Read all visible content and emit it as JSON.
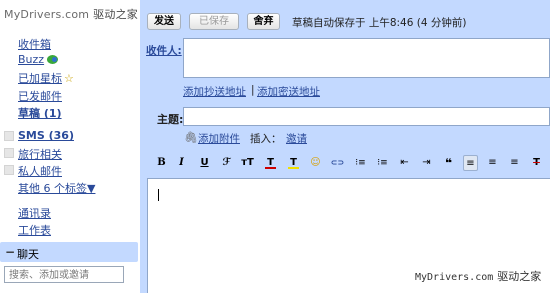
{
  "logo": {
    "text": "MyDrivers.com",
    "cn": "驱动之家"
  },
  "sidebar": {
    "items": [
      {
        "label": "收件箱"
      },
      {
        "label": "Buzz"
      },
      {
        "label": "已加星标"
      },
      {
        "label": "已发邮件"
      },
      {
        "label": "草稿 (1)"
      }
    ],
    "labels": [
      {
        "label": "SMS (36)"
      },
      {
        "label": "旅行相关"
      },
      {
        "label": "私人邮件"
      },
      {
        "label": "其他 6 个标签▼"
      }
    ],
    "contacts": "通讯录",
    "tasks": "工作表"
  },
  "chat": {
    "title": "聊天",
    "search_placeholder": "搜索、添加或邀请"
  },
  "compose": {
    "send": "发送",
    "saved": "已保存",
    "discard": "舍弃",
    "autosave": "草稿自动保存于 上午8:46 (4 分钟前)",
    "to_label": "收件人:",
    "add_cc": "添加抄送地址",
    "separator": "|",
    "add_bcc": "添加密送地址",
    "subject_label": "主题:",
    "attach": "添加附件",
    "insert": "插入：",
    "invite": "邀请"
  },
  "toolbar": {
    "bold": "B",
    "italic": "I",
    "underline": "U",
    "font": "ℱ",
    "size": "тT",
    "text_color": "T",
    "highlight": "T",
    "emoji": "☺",
    "link": "⊂⊃",
    "ordered_list": "⁝≡",
    "bullet_list": "⁝≡",
    "outdent": "⇤",
    "indent": "⇥",
    "quote": "❝",
    "align_left": "≡",
    "align_center": "≡",
    "align_right": "≡",
    "clear_format": "T"
  },
  "watermark": {
    "site": "MyDrivers.com",
    "cn": "驱动之家"
  },
  "colors": {
    "panel": "#c3d9ff",
    "link": "#2a4a9a",
    "text_color_swatch": "#cc0000",
    "highlight_swatch": "#f0e000"
  }
}
